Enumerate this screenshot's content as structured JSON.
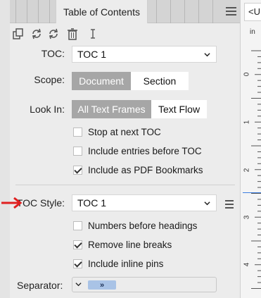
{
  "header": {
    "active_tab": "Table of Contents",
    "menu_icon": "hamburger-menu-icon"
  },
  "toolbar": {
    "icons": [
      "copy-icon",
      "refresh-icon",
      "refresh-alt-icon",
      "trash-icon",
      "text-cursor-icon"
    ]
  },
  "form": {
    "toc_label": "TOC:",
    "toc_value": "TOC 1",
    "scope_label": "Scope:",
    "scope_options": [
      "Document",
      "Section"
    ],
    "scope_selected": "Document",
    "lookin_label": "Look In:",
    "lookin_options": [
      "All Text Frames",
      "Text Flow"
    ],
    "lookin_selected": "All Text Frames",
    "checks_top": [
      {
        "label": "Stop at next TOC",
        "checked": false
      },
      {
        "label": "Include entries before TOC",
        "checked": false
      },
      {
        "label": "Include as PDF Bookmarks",
        "checked": true
      }
    ],
    "style_label": "TOC Style:",
    "style_value": "TOC 1",
    "checks_bottom": [
      {
        "label": "Numbers before headings",
        "checked": false
      },
      {
        "label": "Remove line breaks",
        "checked": true
      },
      {
        "label": "Include inline pins",
        "checked": true
      }
    ],
    "separator_label": "Separator:",
    "separator_token": "»"
  },
  "document": {
    "tab_label": "<U",
    "ruler_unit": "in",
    "ruler_numbers": [
      "0",
      "1",
      "2",
      "3",
      "4"
    ]
  },
  "colors": {
    "panel_bg": "#ececec",
    "segment_active": "#a6a6a6",
    "separator_token": "#a9c3e6",
    "annotation_arrow": "#e02020",
    "guide_line": "#3b7de0"
  }
}
